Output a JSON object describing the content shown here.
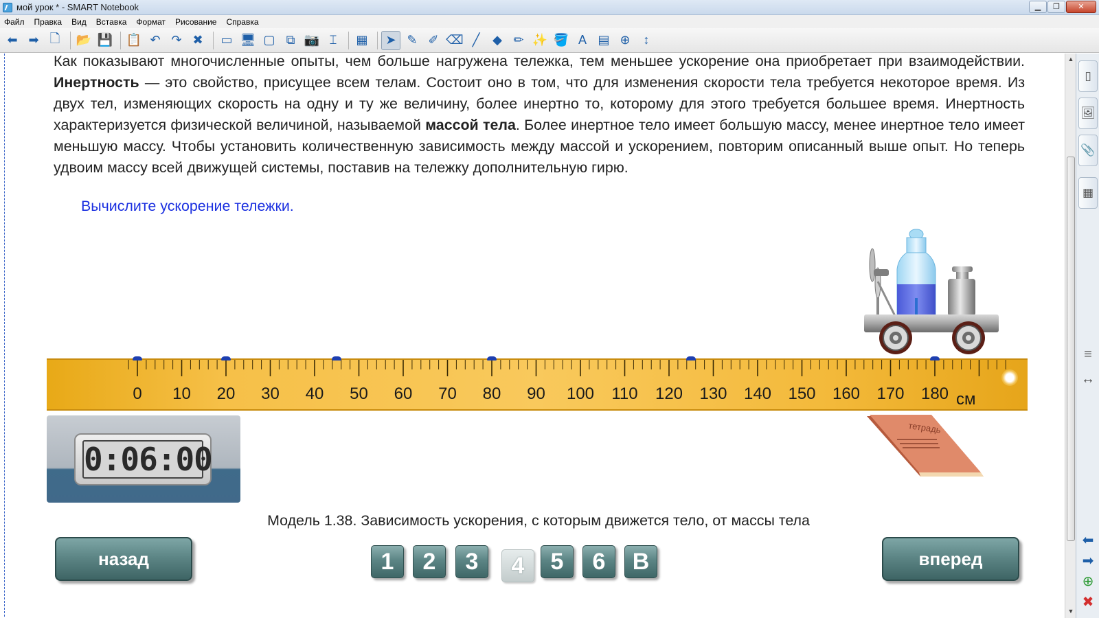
{
  "window": {
    "title": "мой урок * - SMART Notebook",
    "minimize": "▁",
    "restore": "❐",
    "close": "✕"
  },
  "menu": [
    "Файл",
    "Правка",
    "Вид",
    "Вставка",
    "Формат",
    "Рисование",
    "Справка"
  ],
  "toolbar": {
    "icons": [
      {
        "name": "back-arrow-icon",
        "glyph": "⬅"
      },
      {
        "name": "forward-arrow-icon",
        "glyph": "➡"
      },
      {
        "name": "add-page-icon",
        "glyph": "🗋"
      },
      {
        "name": "sep"
      },
      {
        "name": "open-folder-icon",
        "glyph": "📂"
      },
      {
        "name": "save-icon",
        "glyph": "💾"
      },
      {
        "name": "sep"
      },
      {
        "name": "paste-icon",
        "glyph": "📋"
      },
      {
        "name": "undo-icon",
        "glyph": "↶"
      },
      {
        "name": "redo-icon",
        "glyph": "↷"
      },
      {
        "name": "delete-icon",
        "glyph": "✖"
      },
      {
        "name": "sep"
      },
      {
        "name": "screen-shade-icon",
        "glyph": "▭"
      },
      {
        "name": "full-screen-icon",
        "glyph": "🖥"
      },
      {
        "name": "transparent-bg-icon",
        "glyph": "▢"
      },
      {
        "name": "dual-display-icon",
        "glyph": "⧉"
      },
      {
        "name": "screen-capture-icon",
        "glyph": "📷"
      },
      {
        "name": "document-camera-icon",
        "glyph": "⌶"
      },
      {
        "name": "sep"
      },
      {
        "name": "table-icon",
        "glyph": "▦"
      },
      {
        "name": "sep"
      },
      {
        "name": "select-pointer-icon",
        "glyph": "➤",
        "active": true
      },
      {
        "name": "pen-icon",
        "glyph": "✎"
      },
      {
        "name": "creative-pen-icon",
        "glyph": "✐"
      },
      {
        "name": "eraser-icon",
        "glyph": "⌫"
      },
      {
        "name": "line-icon",
        "glyph": "╱"
      },
      {
        "name": "shapes-icon",
        "glyph": "◆"
      },
      {
        "name": "shape-recognition-pen-icon",
        "glyph": "✏"
      },
      {
        "name": "magic-pen-icon",
        "glyph": "✨"
      },
      {
        "name": "fill-icon",
        "glyph": "🪣"
      },
      {
        "name": "text-icon",
        "glyph": "A"
      },
      {
        "name": "properties-icon",
        "glyph": "▤"
      },
      {
        "name": "measurement-tools-icon",
        "glyph": "⊕"
      },
      {
        "name": "toolbar-move-icon",
        "glyph": "↕"
      }
    ]
  },
  "content": {
    "paragraph_1": "Как показывают многочисленные опыты, чем больше нагружена тележка, тем меньшее ускорение она приобретает при взаимодействии. ",
    "bold_1": "Инертность",
    "paragraph_2": " — это свойство, присущее всем телам. Состоит оно в том, что для изменения скорости тела требуется некоторое время. Из двух тел, изменяющих скорость на одну и ту же величину, более инертно то, которому для этого требуется большее время. Инертность характеризуется физической величиной, называемой ",
    "bold_2": "массой тела",
    "paragraph_3": ". Более инертное тело имеет большую массу, менее инертное тело имеет меньшую массу. Чтобы установить количественную зависимость между массой и ускорением, повторим описанный выше опыт. Но теперь удвоим массу всей движущей системы, поставив на тележку дополнительную гирю.",
    "task": "Вычислите ускорение тележки."
  },
  "ruler": {
    "labels": [
      "0",
      "10",
      "20",
      "30",
      "40",
      "50",
      "60",
      "70",
      "80",
      "90",
      "100",
      "110",
      "120",
      "130",
      "140",
      "150",
      "160",
      "170",
      "180"
    ],
    "unit": "см",
    "markers_cm": [
      0,
      20,
      45,
      80,
      125,
      180
    ]
  },
  "timer": {
    "display": "0:06:00"
  },
  "notebook": {
    "label": "тетрадь"
  },
  "caption": "Модель 1.38. Зависимость ускорения, с которым движется тело, от массы тела",
  "nav": {
    "back": "назад",
    "forward": "вперед",
    "pages": [
      "1",
      "2",
      "3",
      "4",
      "5",
      "6",
      "В"
    ],
    "current_page": "4"
  },
  "sidebar": {
    "tab_glyphs": [
      "▯",
      "🖼",
      "📎",
      "▦"
    ],
    "collapse_glyph": "≡",
    "expand_glyph": "↔"
  },
  "colors": {
    "task_text": "#1a2fe0",
    "button_teal": "#5d8686",
    "ruler_yellow": "#f6c048"
  }
}
